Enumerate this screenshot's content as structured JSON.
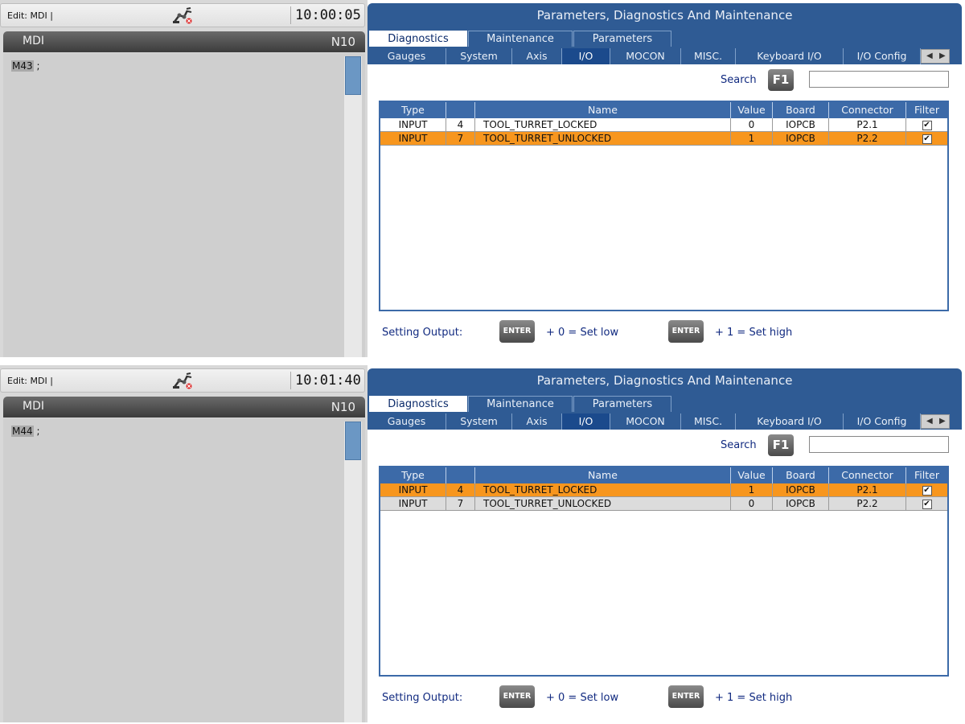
{
  "screens": [
    {
      "edit_label": "Edit: MDI |",
      "clock": "10:00:05",
      "mdi": {
        "title": "MDI",
        "line_number": "N10",
        "code_command": "M43",
        "code_suffix": " ;"
      },
      "panel": {
        "title": "Parameters, Diagnostics And Maintenance",
        "top_tabs": [
          "Diagnostics",
          "Maintenance",
          "Parameters"
        ],
        "sub_tabs": [
          "Gauges",
          "System",
          "Axis",
          "I/O",
          "MOCON",
          "MISC.",
          "Keyboard I/O",
          "I/O Config"
        ],
        "search_label": "Search",
        "search_key": "F1",
        "search_value": "",
        "columns": [
          "Type",
          "",
          "Name",
          "Value",
          "Board",
          "Connector",
          "Filter"
        ],
        "rows": [
          {
            "type": "INPUT",
            "num": "4",
            "name": "TOOL_TURRET_LOCKED",
            "value": "0",
            "board": "IOPCB",
            "connector": "P2.1",
            "filter": "✔",
            "highlighted": false
          },
          {
            "type": "INPUT",
            "num": "7",
            "name": "TOOL_TURRET_UNLOCKED",
            "value": "1",
            "board": "IOPCB",
            "connector": "P2.2",
            "filter": "✔",
            "highlighted": true
          }
        ],
        "setting_output_label": "Setting Output:",
        "enter_key": "ENTER",
        "set_low": "+ 0 = Set low",
        "set_high": "+ 1 = Set high"
      }
    },
    {
      "edit_label": "Edit: MDI |",
      "clock": "10:01:40",
      "mdi": {
        "title": "MDI",
        "line_number": "N10",
        "code_command": "M44",
        "code_suffix": " ;"
      },
      "panel": {
        "title": "Parameters, Diagnostics And Maintenance",
        "top_tabs": [
          "Diagnostics",
          "Maintenance",
          "Parameters"
        ],
        "sub_tabs": [
          "Gauges",
          "System",
          "Axis",
          "I/O",
          "MOCON",
          "MISC.",
          "Keyboard I/O",
          "I/O Config"
        ],
        "search_label": "Search",
        "search_key": "F1",
        "search_value": "",
        "columns": [
          "Type",
          "",
          "Name",
          "Value",
          "Board",
          "Connector",
          "Filter"
        ],
        "rows": [
          {
            "type": "INPUT",
            "num": "4",
            "name": "TOOL_TURRET_LOCKED",
            "value": "1",
            "board": "IOPCB",
            "connector": "P2.1",
            "filter": "✔",
            "highlighted": true
          },
          {
            "type": "INPUT",
            "num": "7",
            "name": "TOOL_TURRET_UNLOCKED",
            "value": "0",
            "board": "IOPCB",
            "connector": "P2.2",
            "filter": "✔",
            "highlighted": false
          }
        ],
        "setting_output_label": "Setting Output:",
        "enter_key": "ENTER",
        "set_low": "+ 0 = Set low",
        "set_high": "+ 1 = Set high"
      }
    }
  ],
  "colors": {
    "panel_blue": "#2f5b94",
    "highlight_orange": "#f7961e",
    "header_blue": "#3c6aa8"
  }
}
